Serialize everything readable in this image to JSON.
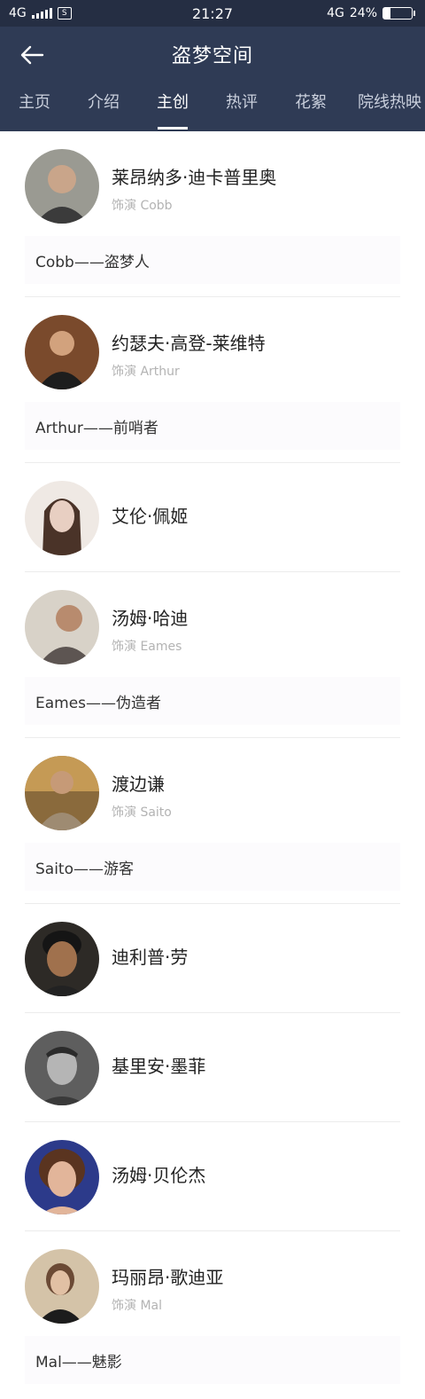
{
  "status": {
    "network_left": "4G",
    "time": "21:27",
    "network_right": "4G",
    "battery": "24%"
  },
  "header": {
    "title": "盗梦空间"
  },
  "tabs": [
    {
      "label": "主页"
    },
    {
      "label": "介绍"
    },
    {
      "label": "主创"
    },
    {
      "label": "热评"
    },
    {
      "label": "花絮"
    },
    {
      "label": "院线热映"
    }
  ],
  "cast": [
    {
      "name": "莱昂纳多·迪卡普里奥",
      "role": "饰演 Cobb",
      "character": "Cobb——盗梦人",
      "avatar_color": "#5b5e5a"
    },
    {
      "name": "约瑟夫·高登-莱维特",
      "role": "饰演 Arthur",
      "character": "Arthur——前哨者",
      "avatar_color": "#7a4a2c"
    },
    {
      "name": "艾伦·佩姬",
      "role": "",
      "character": "",
      "avatar_color": "#d9cfc8"
    },
    {
      "name": "汤姆·哈迪",
      "role": "饰演 Eames",
      "character": "Eames——伪造者",
      "avatar_color": "#8b6d5b"
    },
    {
      "name": "渡边谦",
      "role": "饰演 Saito",
      "character": "Saito——游客",
      "avatar_color": "#a78052"
    },
    {
      "name": "迪利普·劳",
      "role": "",
      "character": "",
      "avatar_color": "#6a4a33"
    },
    {
      "name": "基里安·墨菲",
      "role": "",
      "character": "",
      "avatar_color": "#6e6e6e"
    },
    {
      "name": "汤姆·贝伦杰",
      "role": "",
      "character": "",
      "avatar_color": "#3a3f8a"
    },
    {
      "name": "玛丽昂·歌迪亚",
      "role": "饰演 Mal",
      "character": "Mal——魅影",
      "avatar_color": "#b89a78"
    }
  ]
}
